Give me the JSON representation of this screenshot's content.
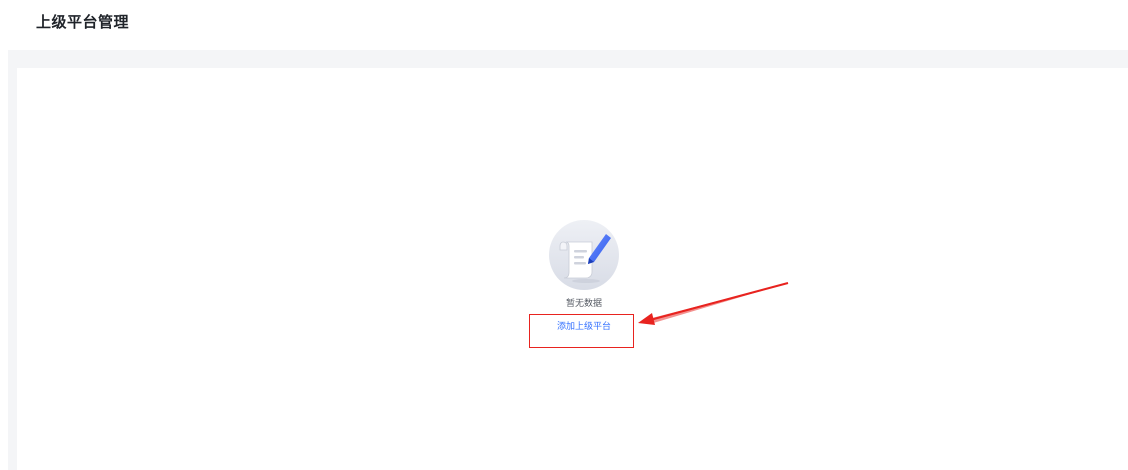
{
  "header": {
    "title": "上级平台管理"
  },
  "empty_state": {
    "icon": "document-edit-illustration-icon",
    "message": "暂无数据",
    "action_label": "添加上级平台"
  },
  "annotation": {
    "icon": "red-arrow-icon",
    "highlight_color": "#e8231f"
  },
  "colors": {
    "accent": "#3370ff",
    "page_background": "#f4f5f7",
    "card_background": "#ffffff"
  }
}
